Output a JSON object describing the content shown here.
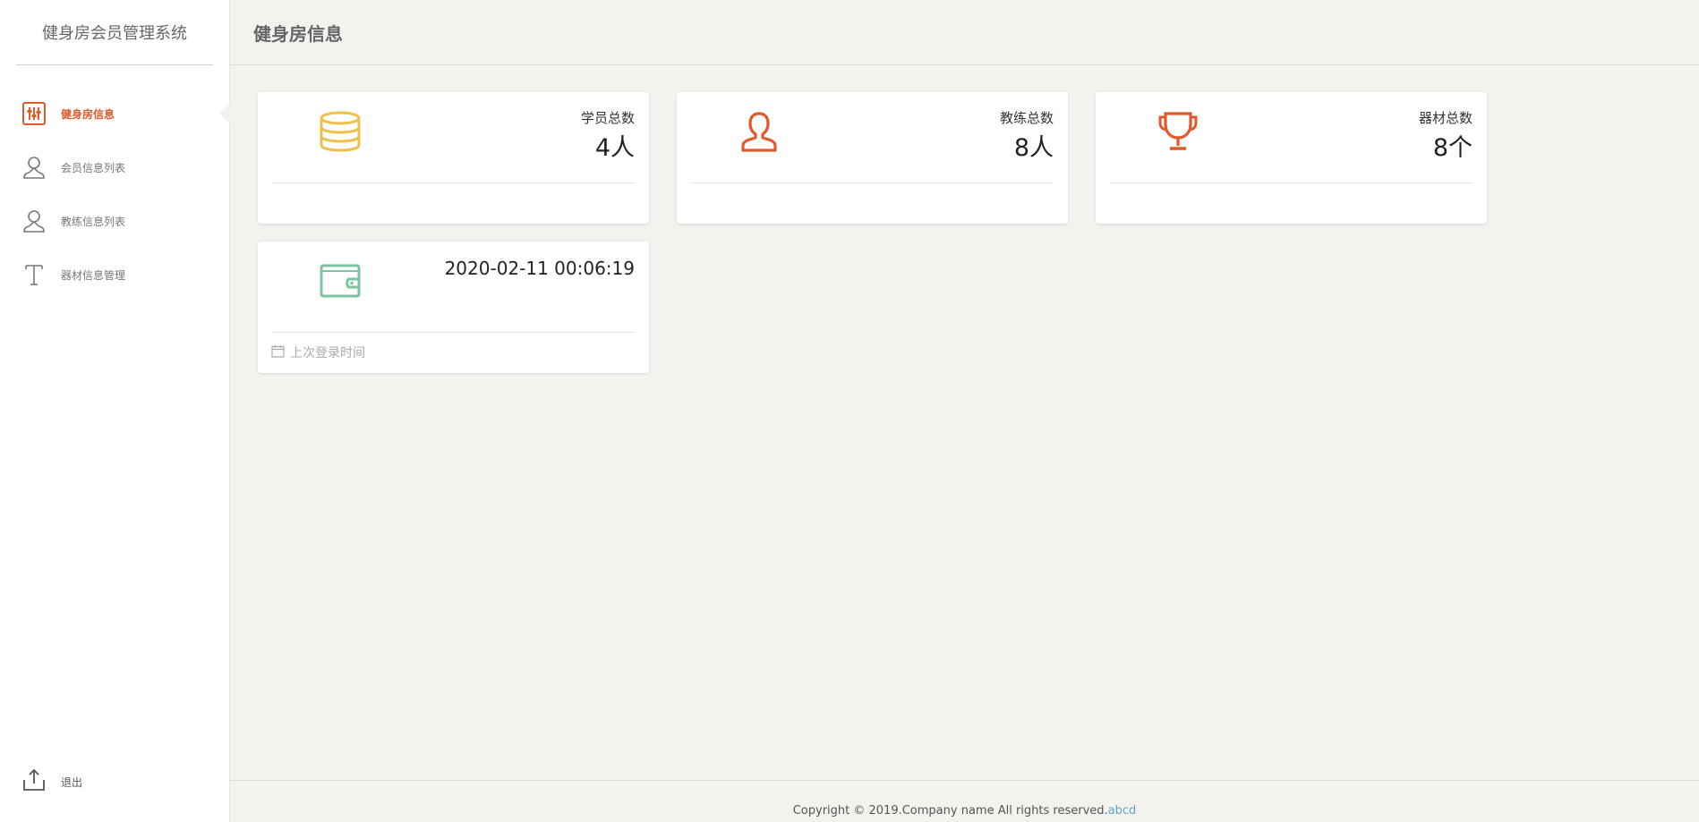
{
  "brand": {
    "title": "健身房会员管理系统"
  },
  "nav": {
    "items": [
      {
        "label": "健身房信息",
        "icon": "sliders-icon",
        "active": true
      },
      {
        "label": "会员信息列表",
        "icon": "user-icon",
        "active": false
      },
      {
        "label": "教练信息列表",
        "icon": "user-icon",
        "active": false
      },
      {
        "label": "器材信息管理",
        "icon": "text-t-icon",
        "active": false
      }
    ],
    "logout_label": "退出"
  },
  "header": {
    "title": "健身房信息"
  },
  "cards": {
    "students": {
      "label": "学员总数",
      "value": "4人",
      "icon": "coins-icon",
      "color": "#f0c04a"
    },
    "coaches": {
      "label": "教练总数",
      "value": "8人",
      "icon": "person-icon",
      "color": "#e05a2b"
    },
    "equipment": {
      "label": "器材总数",
      "value": "8个",
      "icon": "trophy-icon",
      "color": "#e05a2b"
    },
    "last_login": {
      "value": "2020-02-11 00:06:19",
      "footer": "上次登录时间",
      "icon": "wallet-icon",
      "color": "#7cc3a0"
    }
  },
  "footer": {
    "text": "Copyright © 2019.Company name All rights reserved.",
    "link": "abcd"
  },
  "colors": {
    "accent": "#e05a2b",
    "link": "#5aa6c8"
  }
}
